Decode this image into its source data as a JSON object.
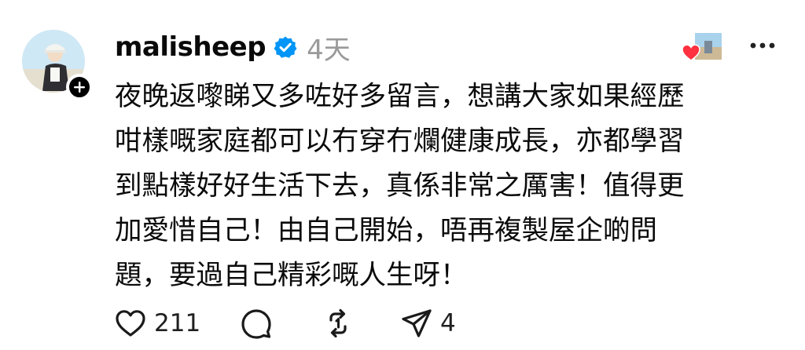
{
  "post": {
    "username": "malisheep",
    "timestamp": "4天",
    "text_lines": [
      "夜晚返嚟睇又多咗好多留言，想講大家如果經歷",
      "咁樣嘅家庭都可以冇穿冇爛健康成長，亦都學習",
      "到點樣好好生活下去，真係非常之厲害！值得更",
      "加愛惜自己！由自己開始，唔再複製屋企啲問",
      "題，要過自己精彩嘅人生呀！"
    ],
    "likes": "211",
    "shares": "4"
  },
  "icons": {
    "verified": "verified-badge-icon",
    "follow": "plus-icon",
    "more": "more-dots-icon",
    "like": "heart-icon",
    "comment": "comment-bubble-icon",
    "repost": "repost-icon",
    "share": "paper-plane-icon",
    "liked_by": "red-heart-icon"
  },
  "colors": {
    "verified_blue": "#0095f6",
    "heart_red": "#ff3040",
    "muted_text": "#9a9a9a"
  }
}
